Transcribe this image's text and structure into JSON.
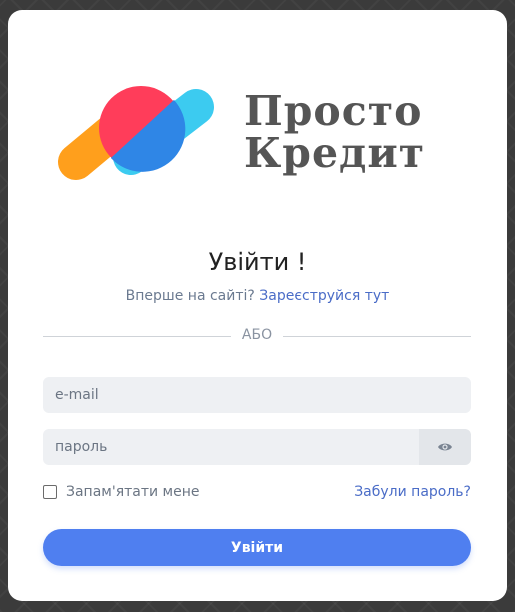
{
  "brand": {
    "line1": "Просто",
    "line2": "Кредит",
    "colors": {
      "orange": "#FF9F1C",
      "red": "#FF3D5A",
      "blue": "#2F86E6",
      "cyan": "#3CCBF0",
      "text": "#555555"
    }
  },
  "login": {
    "title": "Увійти !",
    "signup_prompt": "Вперше на сайті?",
    "signup_link": "Зареєструйся тут",
    "divider_label": "АБО",
    "email_placeholder": "e-mail",
    "password_placeholder": "пароль",
    "remember_label": "Запам'ятати мене",
    "forgot_link": "Забули пароль?",
    "submit_label": "Увійти"
  },
  "icons": {
    "show_password": "eye-icon"
  }
}
